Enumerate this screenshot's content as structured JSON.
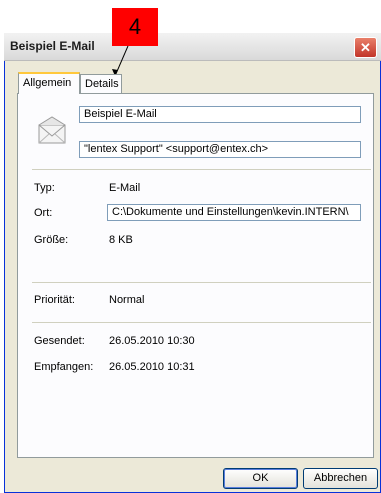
{
  "window": {
    "title": "Beispiel E-Mail",
    "close_symbol": "✕"
  },
  "callout": {
    "label": "4",
    "color": "#ff0000"
  },
  "tabs": [
    {
      "label": "Allgemein"
    },
    {
      "label": "Details"
    }
  ],
  "general": {
    "name_value": "Beispiel E-Mail",
    "sender_value": "\"lentex Support\" <support@entex.ch>",
    "type_label": "Typ:",
    "type_value": "E-Mail",
    "location_label": "Ort:",
    "location_value": "C:\\Dokumente und Einstellungen\\kevin.INTERN\\",
    "size_label": "Größe:",
    "size_value": "8 KB",
    "priority_label": "Priorität:",
    "priority_value": "Normal",
    "sent_label": "Gesendet:",
    "sent_value": "26.05.2010 10:30",
    "received_label": "Empfangen:",
    "received_value": "26.05.2010 10:31"
  },
  "buttons": {
    "ok": "OK",
    "cancel": "Abbrechen"
  }
}
